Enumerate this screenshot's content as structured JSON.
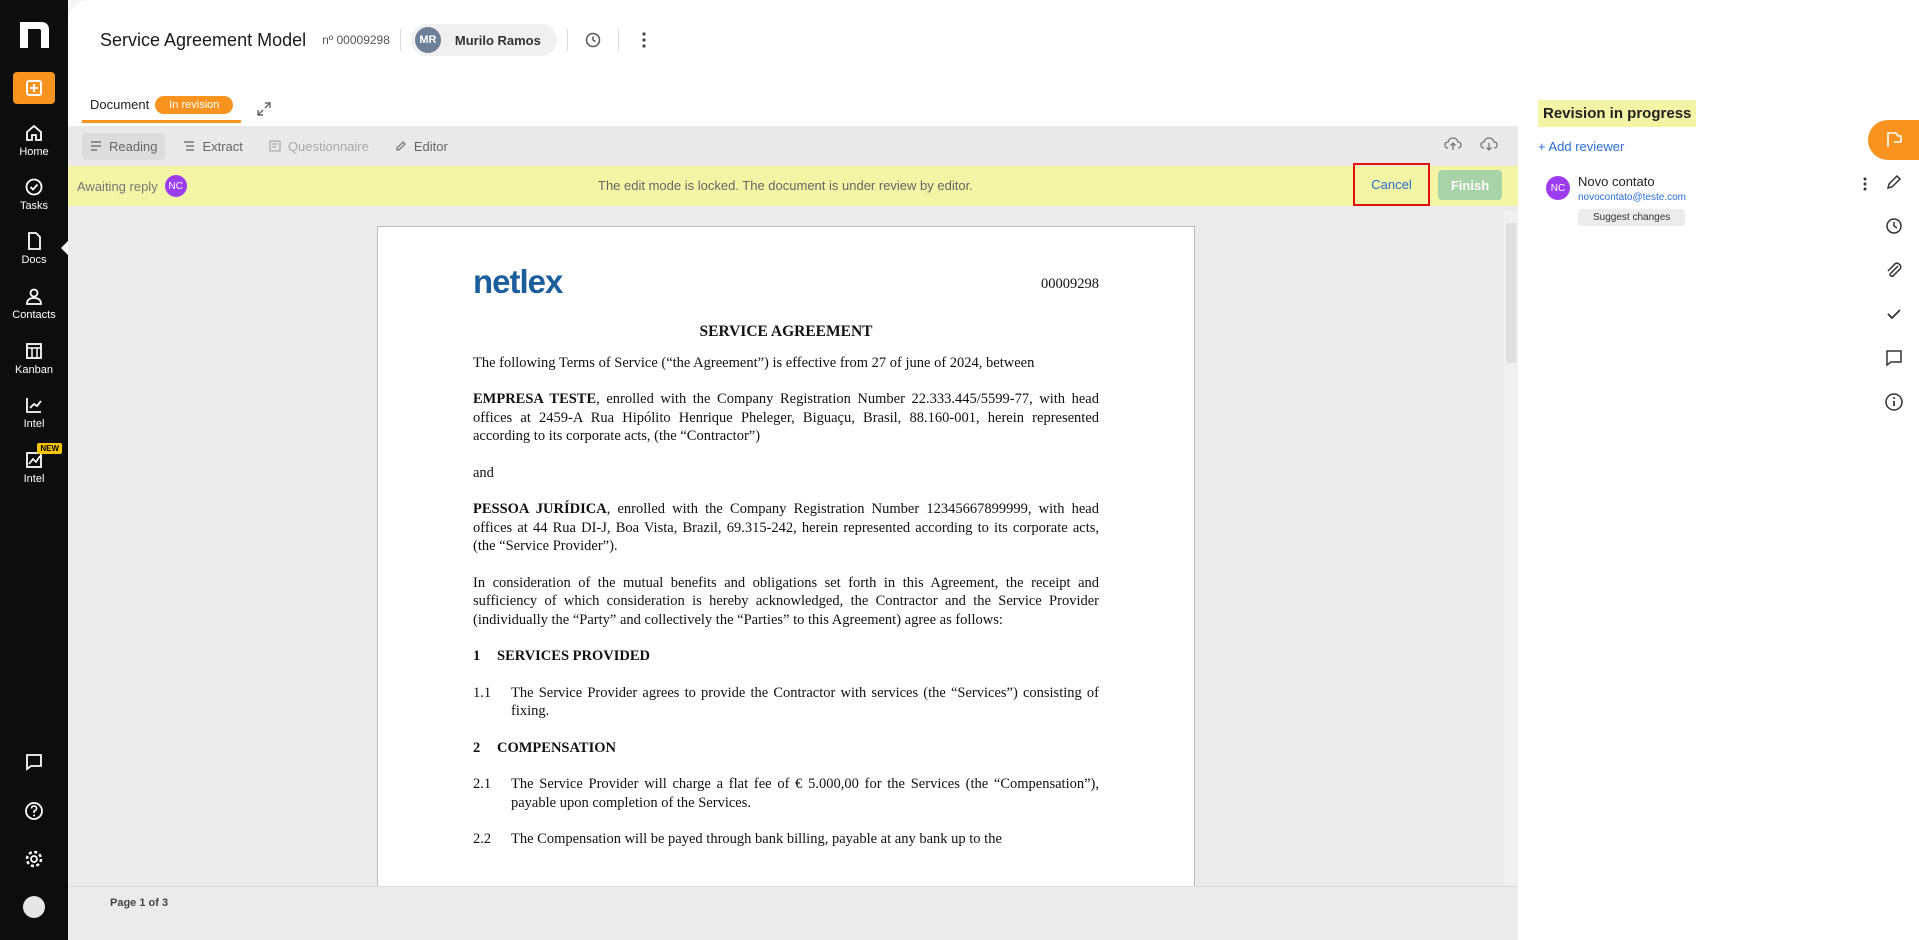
{
  "sidebar": {
    "items": [
      {
        "label": "Home",
        "icon": "home-icon"
      },
      {
        "label": "Tasks",
        "icon": "check-circle-icon"
      },
      {
        "label": "Docs",
        "icon": "file-icon"
      },
      {
        "label": "Contacts",
        "icon": "user-icon"
      },
      {
        "label": "Kanban",
        "icon": "kanban-icon"
      },
      {
        "label": "Intel",
        "icon": "chart-icon"
      },
      {
        "label": "Intel",
        "icon": "chart-new-icon",
        "badge": "NEW"
      }
    ]
  },
  "header": {
    "title": "Service Agreement Model",
    "doc_number": "nº 00009298",
    "user_initials": "MR",
    "user_name": "Murilo Ramos"
  },
  "tabs": {
    "document_label": "Document",
    "status_badge": "In revision"
  },
  "toolbar": {
    "reading": "Reading",
    "extract": "Extract",
    "questionnaire": "Questionnaire",
    "editor": "Editor"
  },
  "lockbar": {
    "awaiting": "Awaiting reply",
    "initials": "NC",
    "message": "The edit mode is locked. The document is under review by editor.",
    "cancel": "Cancel",
    "finish": "Finish"
  },
  "document": {
    "logo_text": "netlex",
    "id": "00009298",
    "title": "SERVICE AGREEMENT",
    "intro": "The following Terms of Service (“the Agreement”) is effective from 27 of june of 2024, between",
    "party1_name": "EMPRESA TESTE",
    "party1_text": ", enrolled with the Company Registration Number 22.333.445/5599-77, with head offices at 2459-A Rua Hipólito Henrique Pheleger, Biguaçu, Brasil, 88.160-001, herein represented according to its corporate acts, (the “Contractor”)",
    "and": "and",
    "party2_name": "PESSOA JURÍDICA",
    "party2_text": ", enrolled with the Company Registration Number 12345667899999, with head offices at 44 Rua DI-J, Boa Vista, Brazil, 69.315-242, herein represented according to its corporate acts, (the “Service Provider”).",
    "consideration": "In consideration of the mutual benefits and obligations set forth in this Agreement, the receipt and sufficiency of which consideration is hereby acknowledged, the Contractor and the Service Provider (individually the “Party” and collectively the “Parties” to this Agreement) agree as follows:",
    "s1_num": "1",
    "s1_title": "SERVICES PROVIDED",
    "c11_num": "1.1",
    "c11_text": "The Service Provider agrees to provide the Contractor with services (the “Services”) consisting of fixing.",
    "s2_num": "2",
    "s2_title": "COMPENSATION",
    "c21_num": "2.1",
    "c21_text": "The Service Provider will charge a flat fee of € 5.000,00 for the Services (the “Compensation”), payable upon completion of the Services.",
    "c22_num": "2.2",
    "c22_text": "The Compensation will be payed through bank billing, payable at any bank up to the"
  },
  "footer": {
    "page_info": "Page 1 of 3"
  },
  "right_panel": {
    "status": "Revision in progress",
    "add_reviewer": "+ Add reviewer",
    "reviewer_initials": "NC",
    "reviewer_name": "Novo contato",
    "reviewer_email": "novocontato@teste.com",
    "suggest_label": "Suggest changes"
  },
  "colors": {
    "accent": "#f7931e",
    "lockbar": "#f3f5a4",
    "link": "#2a6ed6",
    "reviewer_avatar": "#9c3cf0",
    "cancel_highlight": "#e01010"
  }
}
